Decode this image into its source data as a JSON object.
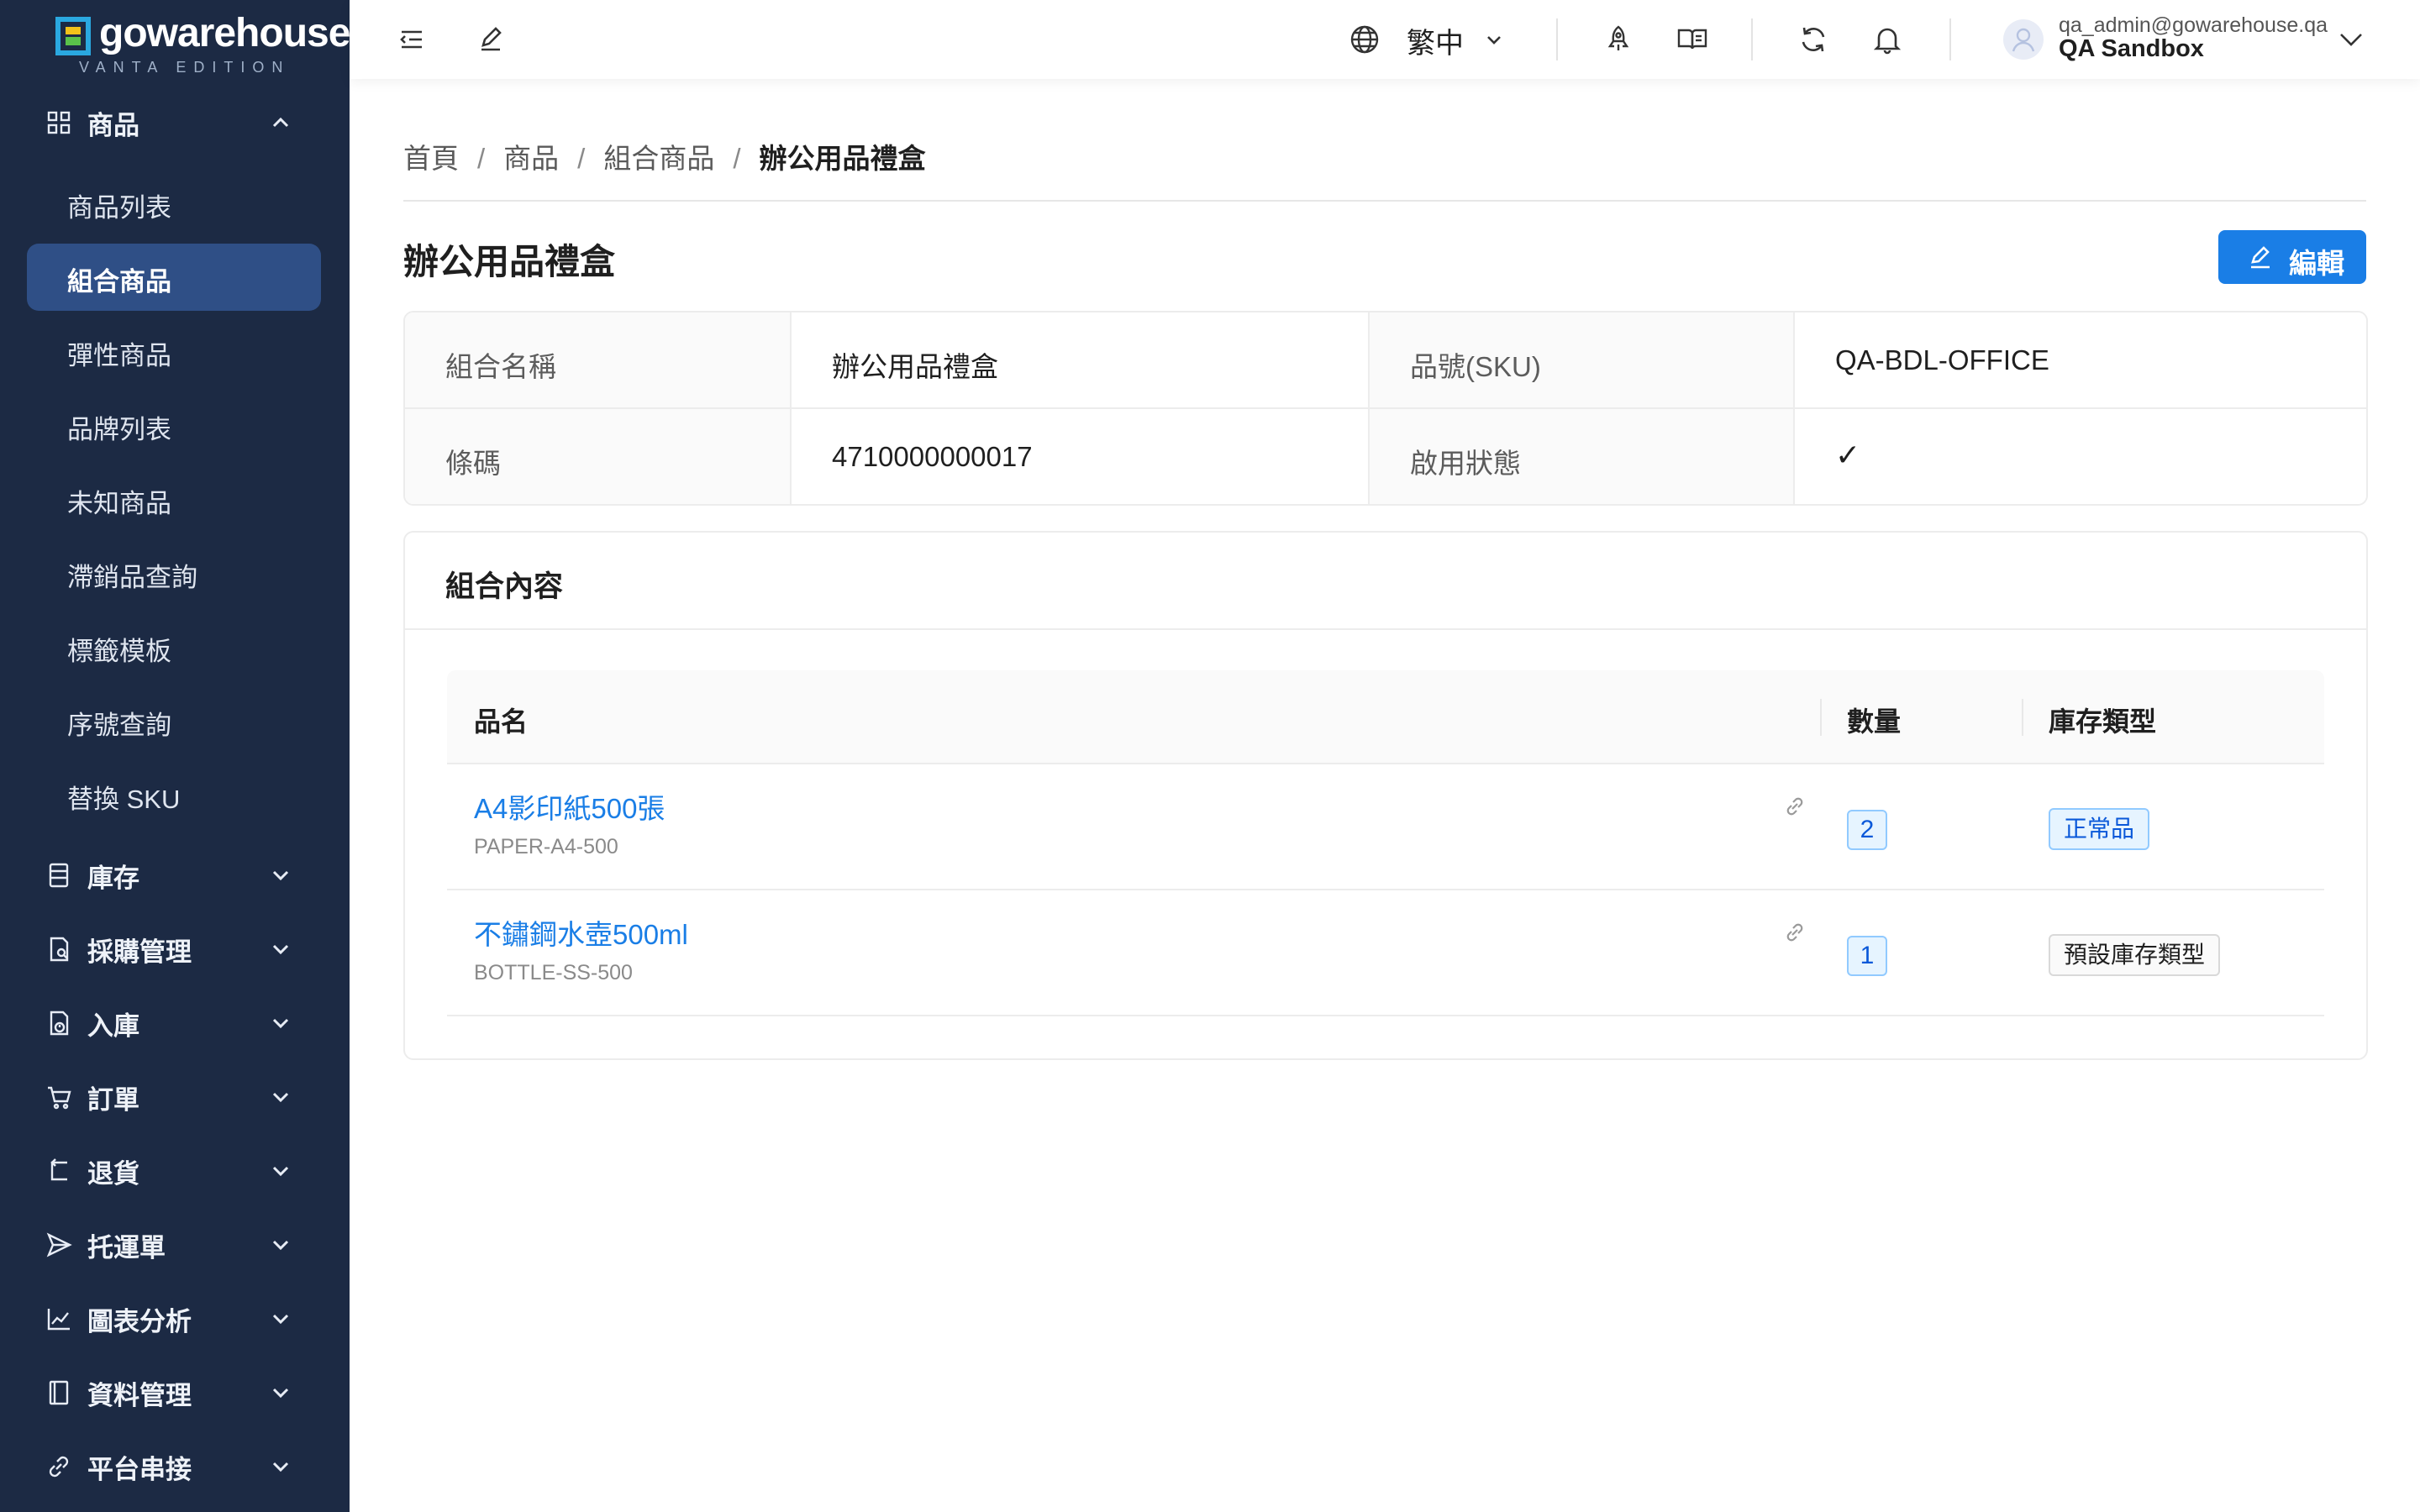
{
  "brand": {
    "name": "gowarehouse",
    "edition": "VANTA EDITION"
  },
  "sidebar": {
    "product_group": "商品",
    "product_items": [
      {
        "label": "商品列表"
      },
      {
        "label": "組合商品"
      },
      {
        "label": "彈性商品"
      },
      {
        "label": "品牌列表"
      },
      {
        "label": "未知商品"
      },
      {
        "label": "滯銷品查詢"
      },
      {
        "label": "標籤模板"
      },
      {
        "label": "序號查詢"
      },
      {
        "label": "替換 SKU"
      }
    ],
    "active_item": "組合商品",
    "groups": [
      {
        "label": "庫存",
        "icon": "inventory-icon"
      },
      {
        "label": "採購管理",
        "icon": "purchase-icon"
      },
      {
        "label": "入庫",
        "icon": "inbound-icon"
      },
      {
        "label": "訂單",
        "icon": "cart-icon"
      },
      {
        "label": "退貨",
        "icon": "return-icon"
      },
      {
        "label": "托運單",
        "icon": "send-icon"
      },
      {
        "label": "圖表分析",
        "icon": "chart-line-icon"
      },
      {
        "label": "資料管理",
        "icon": "book-icon"
      },
      {
        "label": "平台串接",
        "icon": "link-icon"
      }
    ]
  },
  "topbar": {
    "language": "繁中",
    "user_email": "qa_admin@gowarehouse.qa",
    "user_org": "QA Sandbox"
  },
  "breadcrumb": [
    "首頁",
    "商品",
    "組合商品",
    "辦公用品禮盒"
  ],
  "page": {
    "title": "辦公用品禮盒",
    "edit_label": "編輯"
  },
  "details": {
    "name_label": "組合名稱",
    "name_value": "辦公用品禮盒",
    "sku_label": "品號(SKU)",
    "sku_value": "QA-BDL-OFFICE",
    "barcode_label": "條碼",
    "barcode_value": "4710000000017",
    "status_label": "啟用狀態",
    "status_value": "✓"
  },
  "bundle": {
    "title": "組合內容",
    "columns": {
      "name": "品名",
      "qty": "數量",
      "stock_type": "庫存類型"
    },
    "rows": [
      {
        "name": "A4影印紙500張",
        "sku": "PAPER-A4-500",
        "qty": "2",
        "stock_type": "正常品"
      },
      {
        "name": "不鏽鋼水壺500ml",
        "sku": "BOTTLE-SS-500",
        "qty": "1",
        "stock_type": "預設庫存類型"
      }
    ]
  },
  "colors": {
    "sidebar_bg": "#1c2a44",
    "active_bg": "#2f4f86",
    "primary": "#1a7ee6"
  }
}
